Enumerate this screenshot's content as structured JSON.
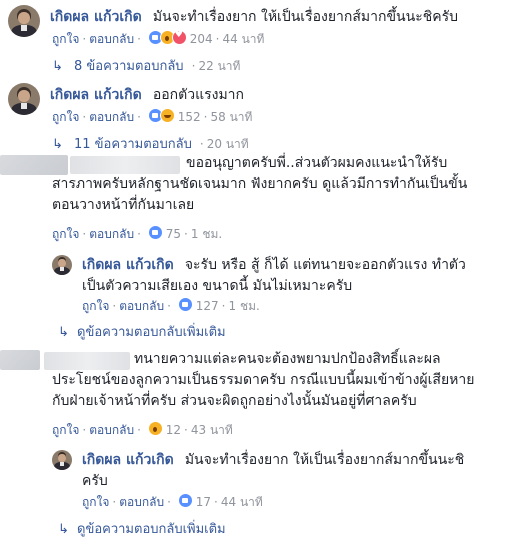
{
  "comments": [
    {
      "author": "เกิดผล แก้วเกิด",
      "text": "มันจะทำเรื่องยาก ให้เป็นเรื่องยากส์มากขึ้นนะชิครับ",
      "like": "ถูกใจ",
      "reply": "ตอบกลับ",
      "reactions": [
        "like",
        "wow",
        "love"
      ],
      "reaction_count": "204",
      "time": "44 นาที",
      "replies_link": "8 ข้อความตอบกลับ",
      "replies_time": "22 นาที"
    },
    {
      "author": "เกิดผล แก้วเกิด",
      "text": "ออกตัวแรงมาก",
      "like": "ถูกใจ",
      "reply": "ตอบกลับ",
      "reactions": [
        "like",
        "haha"
      ],
      "reaction_count": "152",
      "time": "58 นาที",
      "replies_link": "11 ข้อความตอบกลับ",
      "replies_time": "20 นาที"
    },
    {
      "author": "",
      "text_line1": "ขออนุญาตครับพี่..ส่วนตัวผมคงแนะนำให้รับ",
      "text_line2": "สารภาพครับหลักฐานชัดเจนมาก ฟังยากครับ ดูแล้วมีการทำกันเป็นขั้น",
      "text_line3": "ตอนวางหน้าที่กันมาเลย",
      "like": "ถูกใจ",
      "reply": "ตอบกลับ",
      "reactions": [
        "like"
      ],
      "reaction_count": "75",
      "time": "1 ชม.",
      "reply_item": {
        "author": "เกิดผล แก้วเกิด",
        "text_line1": "จะรับ หรือ สู้ ก็ได้ แต่ทนายจะออกตัวแรง ทำตัว",
        "text_line2": "เป็นตัวความเสียเอง ขนาดนี้ มันไม่เหมาะครับ",
        "like": "ถูกใจ",
        "reply": "ตอบกลับ",
        "reactions": [
          "like"
        ],
        "reaction_count": "127",
        "time": "1 ชม."
      },
      "more_replies": "ดูข้อความตอบกลับเพิ่มเติม"
    },
    {
      "author": "",
      "text_line1": "ทนายความแต่ละคนจะต้องพยามปกป้องสิทธิ์และผล",
      "text_line2": "ประโยชน์ของลูกความเป็นธรรมดาครับ กรณีแบบนี้ผมเข้าข้างผู้เสียหาย",
      "text_line3": "กับฝ่ายเจ้าหน้าที่ครับ ส่วนจะผิดถูกอย่างไงนั้นมันอยู่ที่ศาลครับ",
      "like": "ถูกใจ",
      "reply": "ตอบกลับ",
      "reactions": [
        "wow"
      ],
      "reaction_count": "12",
      "time": "43 นาที",
      "reply_item": {
        "author": "เกิดผล แก้วเกิด",
        "text_line1": "มันจะทำเรื่องยาก ให้เป็นเรื่องยากส์มากขึ้นนะชิ",
        "text_line2": "ครับ",
        "like": "ถูกใจ",
        "reply": "ตอบกลับ",
        "reactions": [
          "like"
        ],
        "reaction_count": "17",
        "time": "44 นาที"
      },
      "more_replies": "ดูข้อความตอบกลับเพิ่มเติม"
    }
  ],
  "colors": {
    "link": "#365899",
    "text": "#1d2129",
    "meta": "#90949c",
    "like": "#5890ff"
  }
}
